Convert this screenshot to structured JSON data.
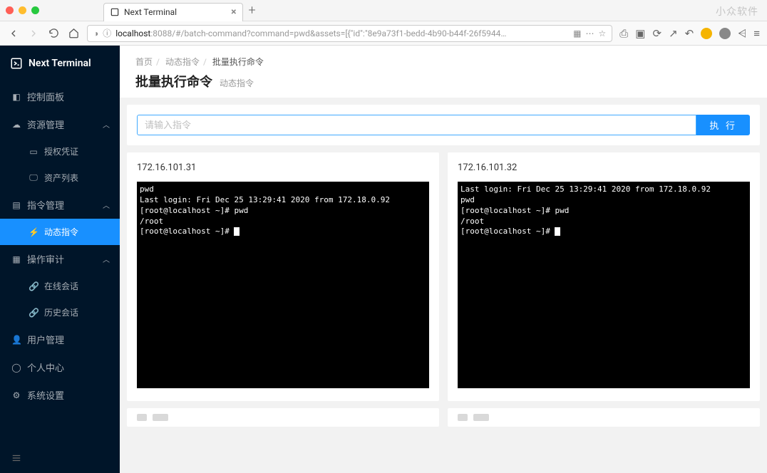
{
  "browser": {
    "tab_title": "Next Terminal",
    "url_prefix": "localhost",
    "url_rest": ":8088/#/batch-command?command=pwd&assets=[{\"id\":\"8e9a73f1-bedd-4b90-b44f-26f5944…",
    "watermark": "小众软件"
  },
  "sidebar": {
    "brand": "Next Terminal",
    "items": [
      {
        "label": "控制面板",
        "icon": "dashboard"
      },
      {
        "label": "资源管理",
        "icon": "cloud",
        "expand": true
      },
      {
        "label": "授权凭证",
        "icon": "idcard",
        "sub": true
      },
      {
        "label": "资产列表",
        "icon": "desktop",
        "sub": true
      },
      {
        "label": "指令管理",
        "icon": "code",
        "expand": true
      },
      {
        "label": "动态指令",
        "icon": "bolt",
        "sub": true,
        "active": true
      },
      {
        "label": "操作审计",
        "icon": "audit",
        "expand": true
      },
      {
        "label": "在线会话",
        "icon": "link",
        "sub": true
      },
      {
        "label": "历史会话",
        "icon": "link",
        "sub": true
      },
      {
        "label": "用户管理",
        "icon": "user"
      },
      {
        "label": "个人中心",
        "icon": "circle"
      },
      {
        "label": "系统设置",
        "icon": "gear"
      }
    ]
  },
  "page": {
    "breadcrumb": [
      "首页",
      "动态指令",
      "批量执行命令"
    ],
    "title": "批量执行命令",
    "subtitle": "动态指令",
    "input_placeholder": "请输入指令",
    "execute_label": "执 行"
  },
  "terminals": [
    {
      "ip": "172.16.101.31",
      "lines": [
        "pwd",
        "Last login: Fri Dec 25 13:29:41 2020 from 172.18.0.92",
        "[root@localhost ~]# pwd",
        "/root",
        "[root@localhost ~]# "
      ]
    },
    {
      "ip": "172.16.101.32",
      "lines": [
        "Last login: Fri Dec 25 13:29:41 2020 from 172.18.0.92",
        "pwd",
        "[root@localhost ~]# pwd",
        "/root",
        "[root@localhost ~]# "
      ]
    }
  ]
}
